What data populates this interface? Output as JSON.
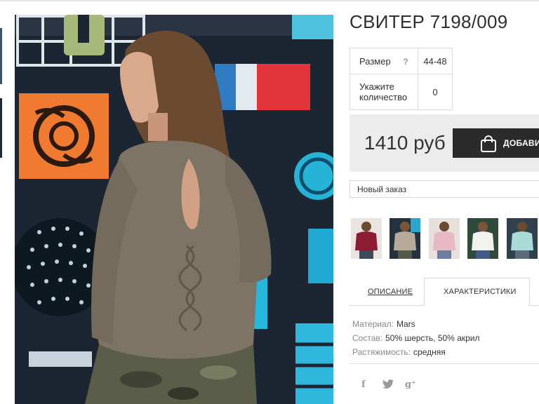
{
  "product": {
    "title": "СВИТЕР 7198/009"
  },
  "size_table": {
    "size_label": "Размер",
    "size_help": "?",
    "size_value": "44-48",
    "qty_label_line1": "Укажите",
    "qty_label_line2": "количество",
    "qty_value": "0"
  },
  "purchase": {
    "price": "1410 руб",
    "buy_label": "ДОБАВИТ",
    "order_select": "Новый заказ"
  },
  "tabs": [
    {
      "label": "ОПИСАНИЕ",
      "active": false
    },
    {
      "label": "ХАРАКТЕРИСТИКИ",
      "active": true
    }
  ],
  "specs": [
    {
      "key": "Материал:",
      "value": "Mars"
    },
    {
      "key": "Состав:",
      "value": "50% шерсть, 50% акрил"
    },
    {
      "key": "Растяжимость:",
      "value": "средняя"
    }
  ],
  "social": {
    "facebook": "f",
    "twitter": "🐦",
    "gplus": "g⁺"
  },
  "colors": {
    "sweater": "#7d7465",
    "button": "#2b2b2b",
    "price_bg": "#ececec"
  }
}
